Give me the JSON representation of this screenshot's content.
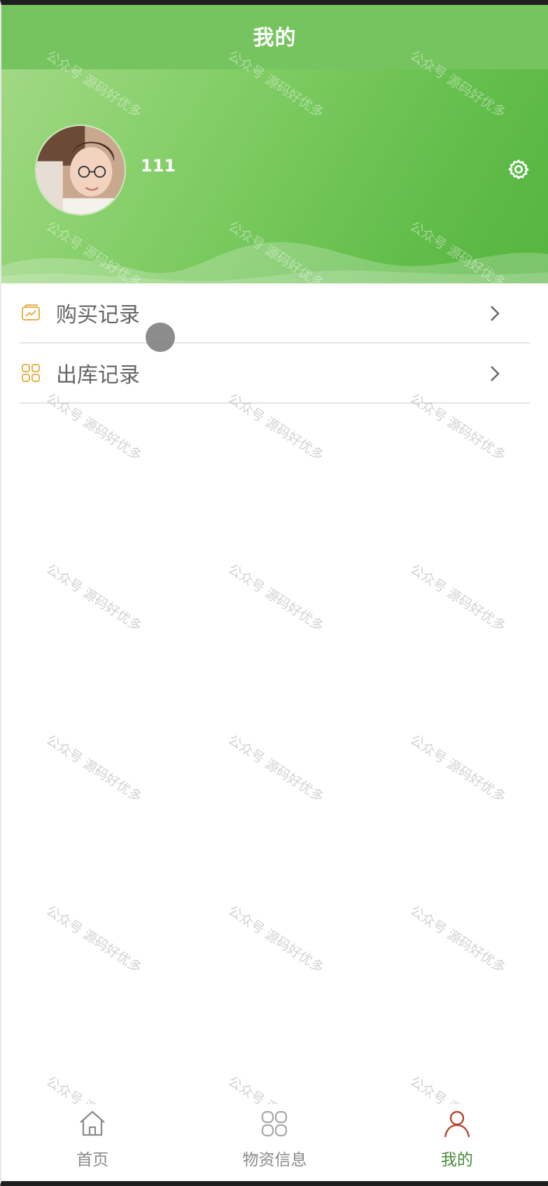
{
  "nav": {
    "title": "我的"
  },
  "profile": {
    "username": "111",
    "avatar_icon": "avatar-photo",
    "settings_icon": "gear-icon"
  },
  "menu": [
    {
      "label": "购买记录",
      "icon": "purchase-record-icon"
    },
    {
      "label": "出库记录",
      "icon": "outbound-record-icon"
    }
  ],
  "tabs": [
    {
      "label": "首页",
      "icon": "home-icon",
      "active": false
    },
    {
      "label": "物资信息",
      "icon": "grid-icon",
      "active": false
    },
    {
      "label": "我的",
      "icon": "user-icon",
      "active": true
    }
  ],
  "watermark": {
    "text": "公众号 源码好优多"
  },
  "colors": {
    "header_green": "#76c45f",
    "accent_gold": "#e8b04a",
    "active_tab": "#4a8a3a",
    "active_icon": "#b8452e"
  }
}
